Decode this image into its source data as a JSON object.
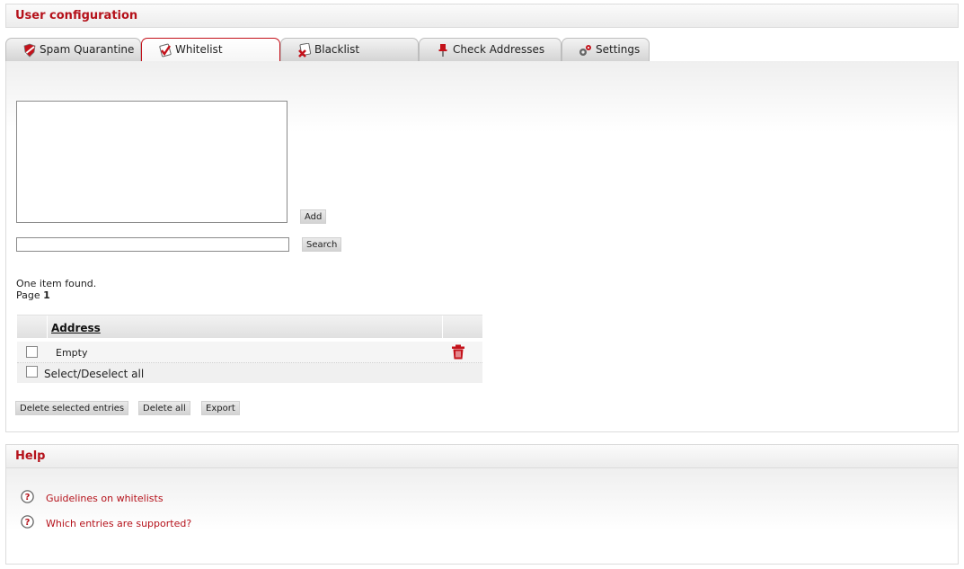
{
  "header": {
    "title": "User configuration"
  },
  "tabs": [
    {
      "label": "Spam Quarantine",
      "icon": "shield-icon",
      "active": false
    },
    {
      "label": "Whitelist",
      "icon": "whitelist-check-icon",
      "active": true
    },
    {
      "label": "Blacklist",
      "icon": "blacklist-x-icon",
      "active": false
    },
    {
      "label": "Check Addresses",
      "icon": "pin-icon",
      "active": false
    },
    {
      "label": "Settings",
      "icon": "gears-icon",
      "active": false
    }
  ],
  "add": {
    "button_label": "Add",
    "textarea_value": ""
  },
  "search": {
    "button_label": "Search",
    "input_value": ""
  },
  "results": {
    "count_text": "One item found.",
    "page_label": "Page",
    "page_number": "1"
  },
  "table": {
    "columns": [
      "Address"
    ],
    "rows": [
      {
        "address": "Empty"
      }
    ],
    "select_all_label": "Select/Deselect all"
  },
  "actions": {
    "delete_selected": "Delete selected entries",
    "delete_all": "Delete all",
    "export": "Export"
  },
  "help": {
    "title": "Help",
    "links": [
      "Guidelines on whitelists",
      "Which entries are supported?"
    ]
  },
  "colors": {
    "accent": "#b5121b",
    "trash": "#c4121b"
  }
}
